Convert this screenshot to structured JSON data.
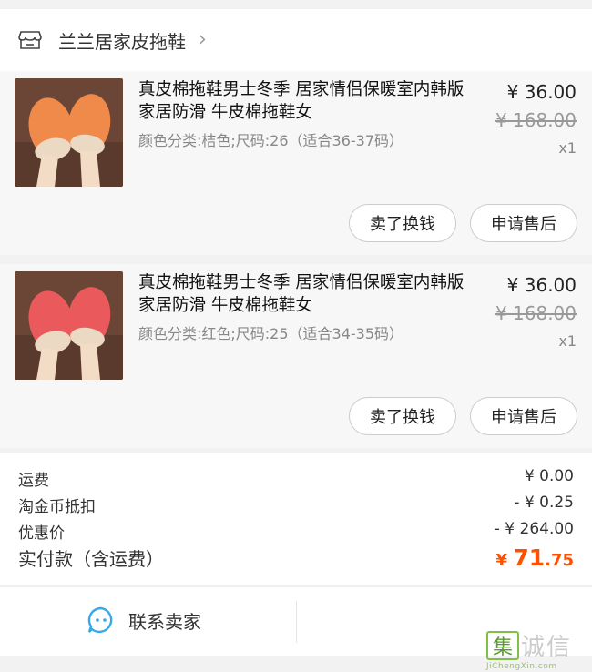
{
  "shop": {
    "name": "兰兰居家皮拖鞋",
    "icon": "store-icon",
    "chevron": "›"
  },
  "items": [
    {
      "title": "真皮棉拖鞋男士冬季 居家情侣保暖室内韩版家居防滑 牛皮棉拖鞋女",
      "sku": "颜色分类:桔色;尺码:26（适合36-37码）",
      "price": "¥ 36.00",
      "original_price": "¥ 168.00",
      "qty": "x1",
      "btn_sell": "卖了换钱",
      "btn_after": "申请售后",
      "color": "#f08a4b"
    },
    {
      "title": "真皮棉拖鞋男士冬季 居家情侣保暖室内韩版家居防滑 牛皮棉拖鞋女",
      "sku": "颜色分类:红色;尺码:25（适合34-35码）",
      "price": "¥ 36.00",
      "original_price": "¥ 168.00",
      "qty": "x1",
      "btn_sell": "卖了换钱",
      "btn_after": "申请售后",
      "color": "#ea5a5c"
    }
  ],
  "summary": {
    "shipping_label": "运费",
    "shipping_value": "¥ 0.00",
    "coin_label": "淘金币抵扣",
    "coin_value": "- ¥ 0.25",
    "discount_label": "优惠价",
    "discount_value": "- ¥ 264.00",
    "total_label": "实付款（含运费）",
    "total_currency": "¥ ",
    "total_int": "71",
    "total_dec": ".75",
    "accent": "#ff5000"
  },
  "footer": {
    "contact_label": "联系卖家",
    "contact_icon": "chat-bubble-icon"
  },
  "watermark": {
    "chars": [
      "集",
      "诚",
      "信"
    ],
    "url": "JiChengXin.com"
  }
}
